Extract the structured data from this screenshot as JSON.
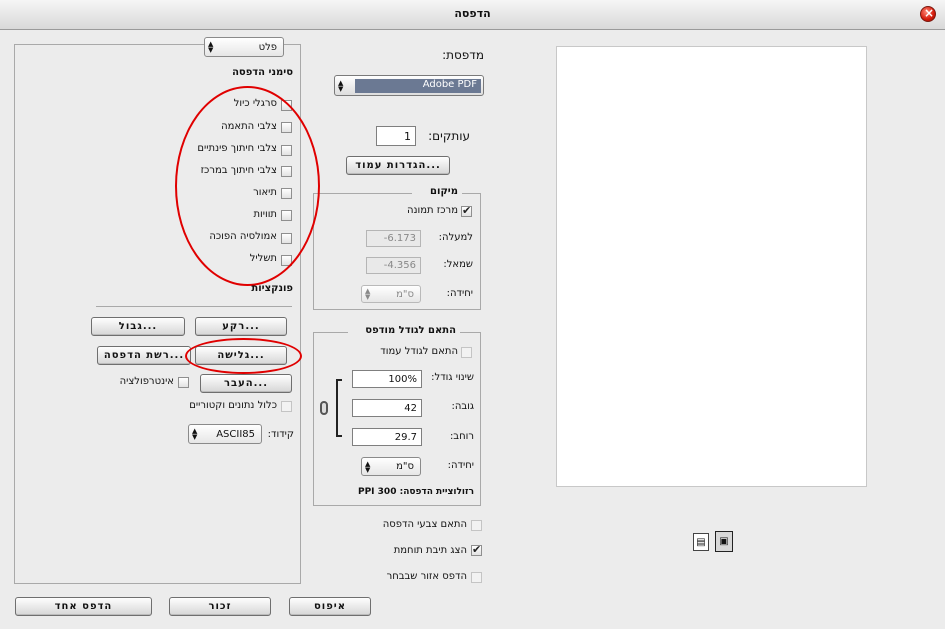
{
  "window": {
    "title": "הדפסה"
  },
  "printer": {
    "label": "מדפסת:",
    "value": "Adobe PDF"
  },
  "copies": {
    "label": "עותקים:",
    "value": "1"
  },
  "page_setup_button": "הגדרות עמוד...",
  "position": {
    "group_label": "מיקום",
    "center_image_label": "מרכז תמונה",
    "top_label": "למעלה:",
    "top_value": "-6.173",
    "left_label": "שמאל:",
    "left_value": "-4.356",
    "units_label": "יחידה:",
    "units_value": "ס\"מ"
  },
  "scale": {
    "group_label": "התאם לגודל מודפס",
    "fit_media_label": "התאם לגודל עמוד",
    "scale_label": "שינוי גודל:",
    "scale_value": "100%",
    "height_label": "גובה:",
    "height_value": "42",
    "width_label": "רוחב:",
    "width_value": "29.7",
    "units_label": "יחידה:",
    "units_value": "ס\"מ",
    "resolution_text": "רזולוציית הדפסה: 300 PPI"
  },
  "options": {
    "match_colors": "התאם צבעי הדפסה",
    "show_bounding_box": "הצג תיבת תוחמת",
    "print_selected_area": "הדפס אזור שבבחר"
  },
  "output": {
    "dropdown_value": "פלט",
    "marks_heading": "סימני הדפסה",
    "marks": [
      {
        "label": "סרגלי כיול"
      },
      {
        "label": "צלבי התאמה"
      },
      {
        "label": "צלבי חיתוך פינתיים"
      },
      {
        "label": "צלבי חיתוך במרכז"
      },
      {
        "label": "תיאור"
      },
      {
        "label": "תוויות"
      },
      {
        "label": "אמולסיה הפוכה"
      },
      {
        "label": "תשליל"
      }
    ],
    "functions_heading": "פונקציות",
    "background_button": "רקע...",
    "border_button": "גבול...",
    "bleed_button": "גלישה...",
    "screen_button": "רשת הדפסה...",
    "transfer_button": "העבר...",
    "interpolation_label": "אינטרפולציה",
    "include_vector_label": "כלול נתונים וקטוריים",
    "encoding_label": "קידוד:",
    "encoding_value": "ASCII85"
  },
  "footer": {
    "print_one_button": "הדפס אחד",
    "remember_button": "זכור",
    "reset_button": "איפוס"
  },
  "colors": {
    "annotation_red": "#e00000",
    "printer_highlight": "#6b7993"
  }
}
